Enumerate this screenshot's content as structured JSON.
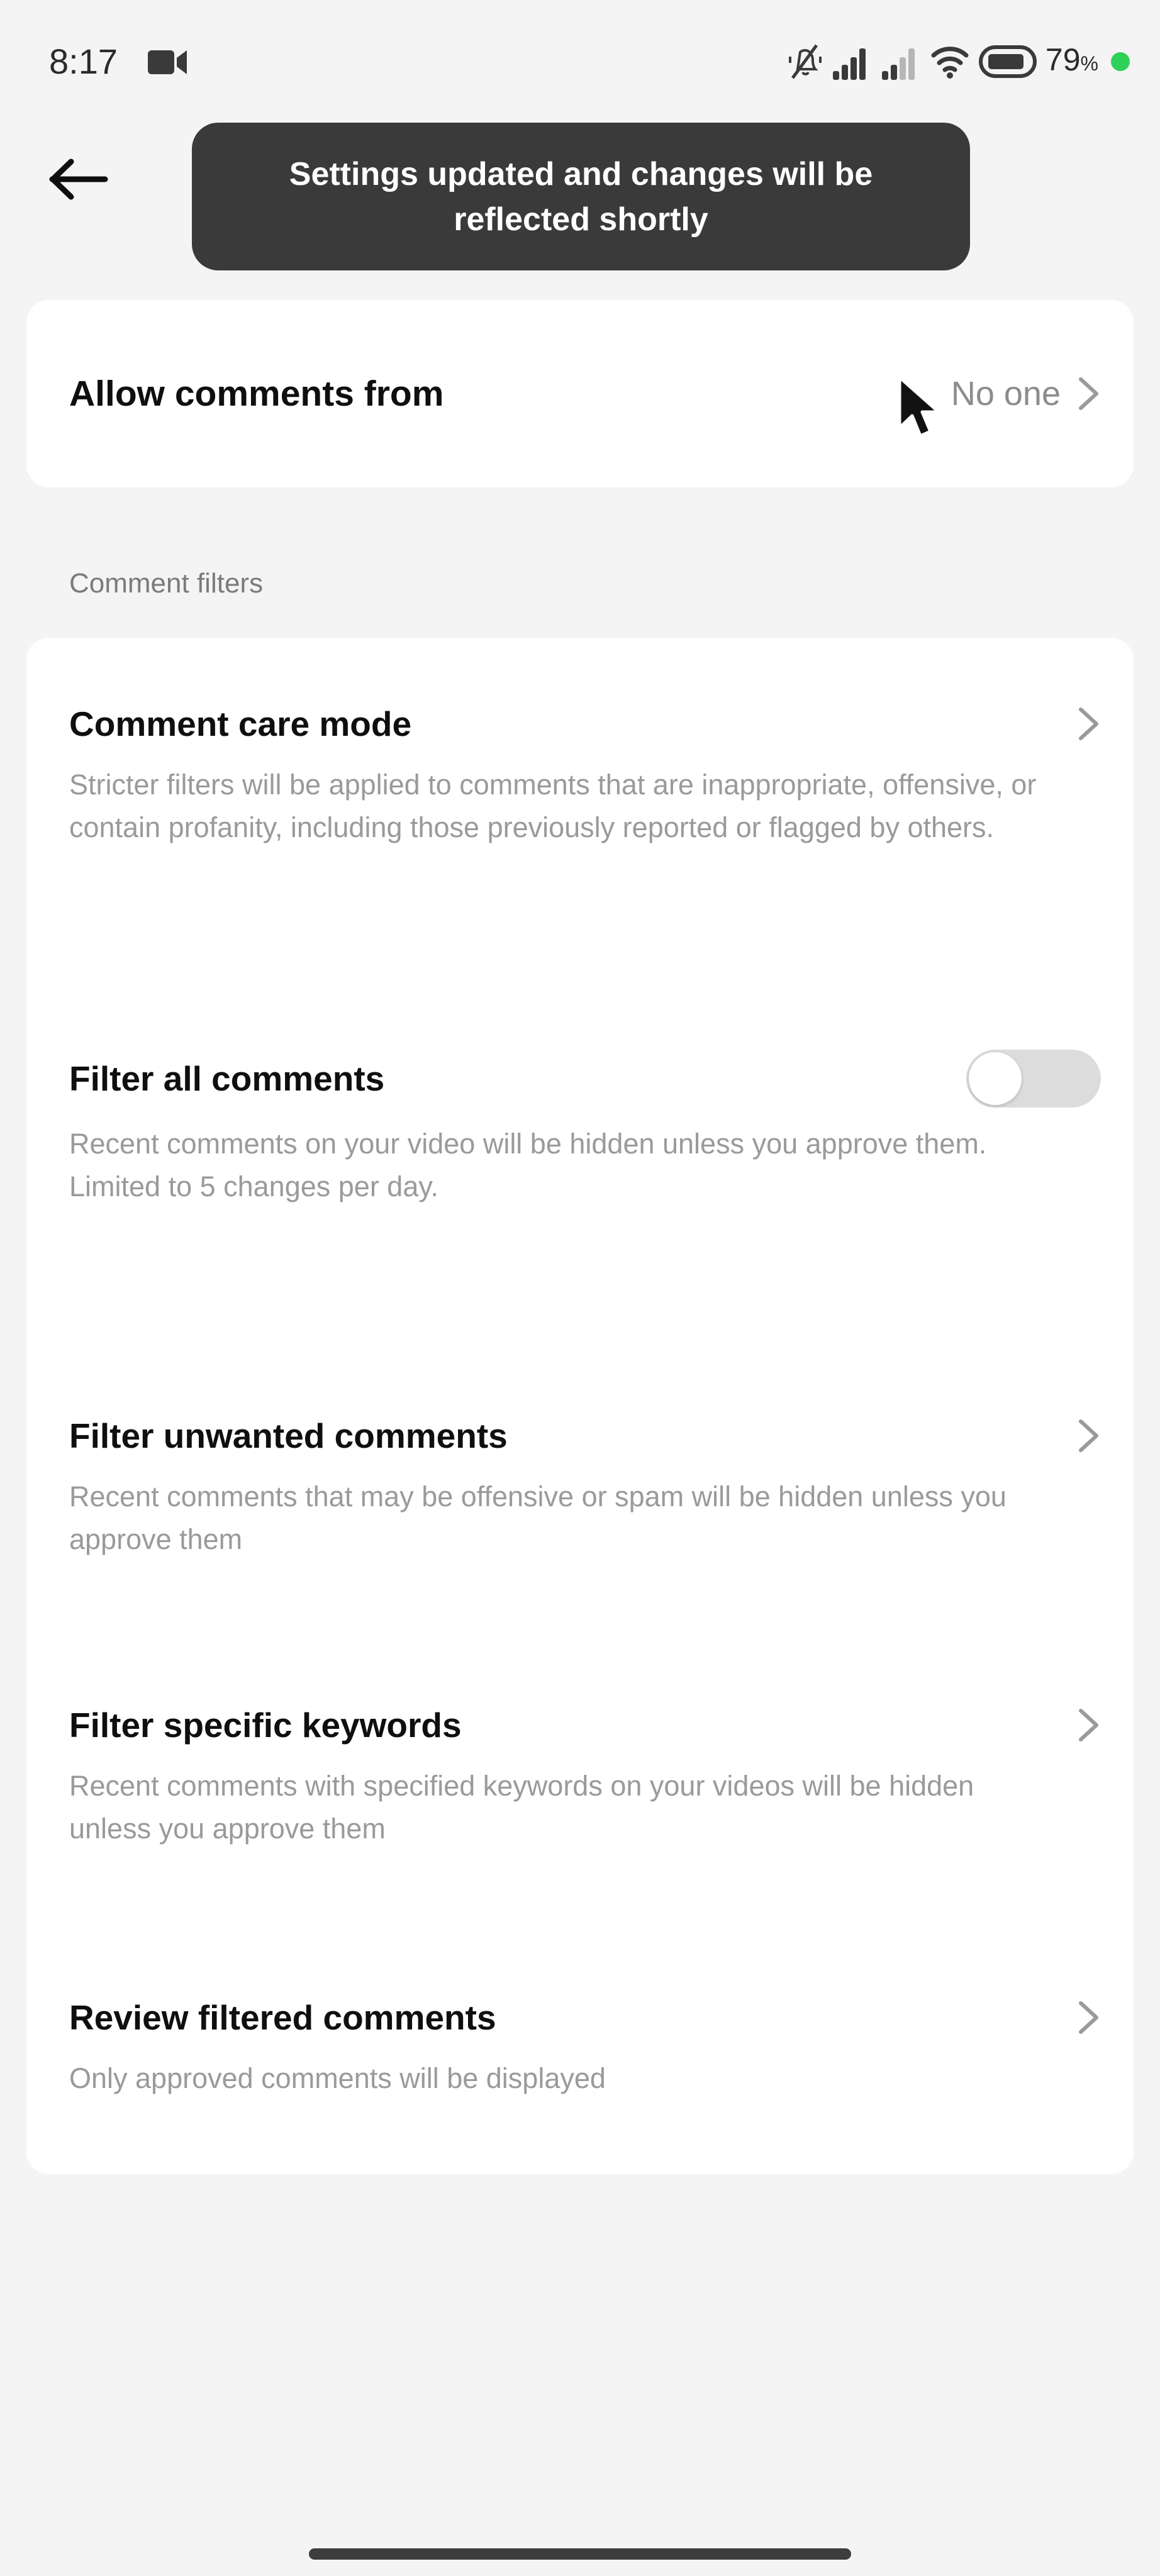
{
  "status_bar": {
    "time": "8:17",
    "battery_percent": "79",
    "percent_symbol": "%",
    "icons": [
      "video-camera-icon",
      "bell-muted-icon",
      "signal-bars-icon",
      "signal-bars-secondary-icon",
      "wifi-icon",
      "battery-icon",
      "recording-dot-icon"
    ]
  },
  "nav": {
    "back_icon": "back-arrow-icon"
  },
  "toast": {
    "message": "Settings updated and changes will be reflected shortly"
  },
  "allow_comments": {
    "title": "Allow comments from",
    "value": "No one",
    "chevron_icon": "chevron-right-icon"
  },
  "section": {
    "label": "Comment filters"
  },
  "filters": [
    {
      "title": "Comment care mode",
      "description": "Stricter filters will be applied to comments that are inappropriate, offensive, or contain profanity, including those previously reported or flagged by others.",
      "control": "chevron"
    },
    {
      "title": "Filter all comments",
      "description": "Recent comments on your video will be hidden unless you approve them. Limited to 5 changes per day.",
      "control": "toggle",
      "toggle_on": false
    },
    {
      "title": "Filter unwanted comments",
      "description": "Recent comments that may be offensive or spam will be hidden unless you approve them",
      "control": "chevron"
    },
    {
      "title": "Filter specific keywords",
      "description": "Recent comments with specified keywords on your videos will be hidden unless you approve them",
      "control": "chevron"
    },
    {
      "title": "Review filtered comments",
      "description": "Only approved comments will be displayed",
      "control": "chevron"
    }
  ],
  "system": {
    "home_indicator": "home-indicator"
  },
  "colors": {
    "page_background": "#f4f4f4",
    "card_background": "#ffffff",
    "primary_text": "#0f0f0f",
    "secondary_text": "#9a9a9a",
    "toast_background": "#3a3a3a",
    "toggle_track_off": "#dcdcdc",
    "status_dot": "#2ed158"
  }
}
